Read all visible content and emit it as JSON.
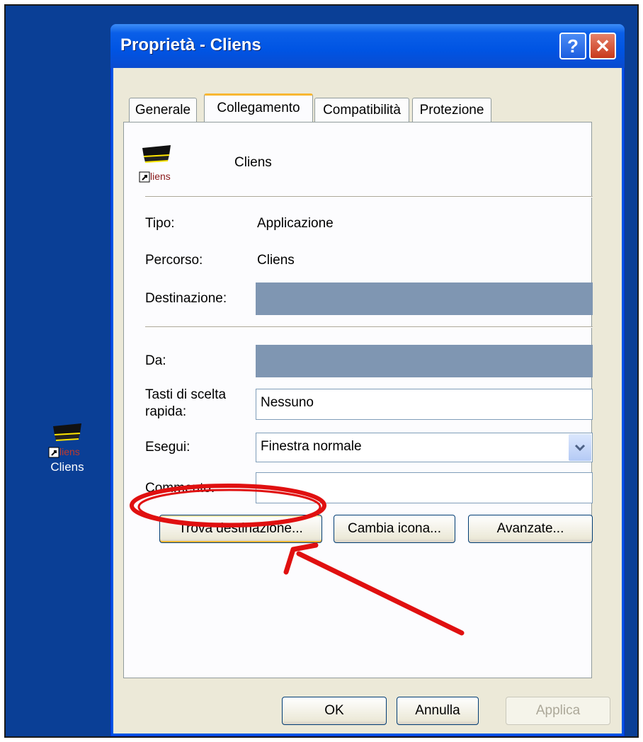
{
  "desktop": {
    "icon_label": "Cliens",
    "icon_subtext": "liens"
  },
  "dialog": {
    "title": "Proprietà - Cliens",
    "help_glyph": "?",
    "close_glyph": "✕",
    "tabs": [
      {
        "label": "Generale",
        "active": false
      },
      {
        "label": "Collegamento",
        "active": true
      },
      {
        "label": "Compatibilità",
        "active": false
      },
      {
        "label": "Protezione",
        "active": false
      }
    ],
    "shortcut": {
      "name": "Cliens",
      "icon_subtext": "liens",
      "type_label": "Tipo:",
      "type_value": "Applicazione",
      "path_label": "Percorso:",
      "path_value": "Cliens",
      "target_label": "Destinazione:",
      "target_value": "",
      "start_in_label": "Da:",
      "start_in_value": "",
      "hotkey_label_line1": "Tasti di scelta",
      "hotkey_label_line2": "rapida:",
      "hotkey_value": "Nessuno",
      "run_label": "Esegui:",
      "run_value": "Finestra normale",
      "comment_label": "Commento:",
      "comment_value": ""
    },
    "buttons": {
      "find_target": "Trova destinazione...",
      "change_icon": "Cambia icona...",
      "advanced": "Avanzate...",
      "ok": "OK",
      "cancel": "Annulla",
      "apply": "Applica"
    }
  },
  "annotation": {
    "color": "#e01010"
  },
  "colors": {
    "desktop": "#0a3f96",
    "title_bar": "#0054e3",
    "dialog_face": "#ece9d8",
    "tab_highlight": "#f8b732"
  }
}
